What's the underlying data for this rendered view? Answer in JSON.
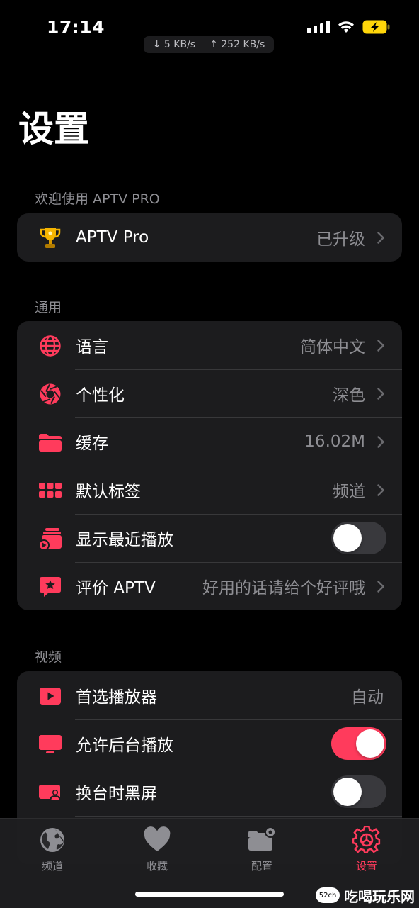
{
  "status_bar": {
    "time": "17:14",
    "download_speed": "↓ 5 KB/s",
    "upload_speed": "↑ 252 KB/s"
  },
  "page_title": "设置",
  "sections": {
    "welcome": {
      "header": "欢迎使用 APTV PRO",
      "rows": [
        {
          "label": "APTV Pro",
          "value": "已升级",
          "icon": "trophy-icon"
        }
      ]
    },
    "general": {
      "header": "通用",
      "rows": [
        {
          "label": "语言",
          "value": "简体中文",
          "icon": "globe-icon"
        },
        {
          "label": "个性化",
          "value": "深色",
          "icon": "aperture-icon"
        },
        {
          "label": "缓存",
          "value": "16.02M",
          "icon": "folder-icon"
        },
        {
          "label": "默认标签",
          "value": "频道",
          "icon": "grid-icon"
        },
        {
          "label": "显示最近播放",
          "toggle": false,
          "icon": "recent-play-icon"
        },
        {
          "label": "评价 APTV",
          "value": "好用的话请给个好评哦",
          "icon": "star-bubble-icon"
        }
      ]
    },
    "video": {
      "header": "视频",
      "rows": [
        {
          "label": "首选播放器",
          "value": "自动",
          "icon": "play-rectangle-icon"
        },
        {
          "label": "允许后台播放",
          "toggle": true,
          "icon": "tv-icon"
        },
        {
          "label": "换台时黑屏",
          "toggle": false,
          "icon": "screen-person-icon"
        }
      ]
    }
  },
  "tab_bar": {
    "tabs": [
      {
        "label": "频道",
        "icon": "globe-icon",
        "active": false
      },
      {
        "label": "收藏",
        "icon": "heart-icon",
        "active": false
      },
      {
        "label": "配置",
        "icon": "folder-gear-icon",
        "active": false
      },
      {
        "label": "设置",
        "icon": "gear-icon",
        "active": true
      }
    ]
  },
  "watermark": {
    "badge": "52ch",
    "text": "吃喝玩乐网"
  },
  "colors": {
    "accent": "#ff3b5c",
    "background": "#000000",
    "group_bg": "#1c1c1e",
    "secondary_text": "#8e8e93"
  }
}
